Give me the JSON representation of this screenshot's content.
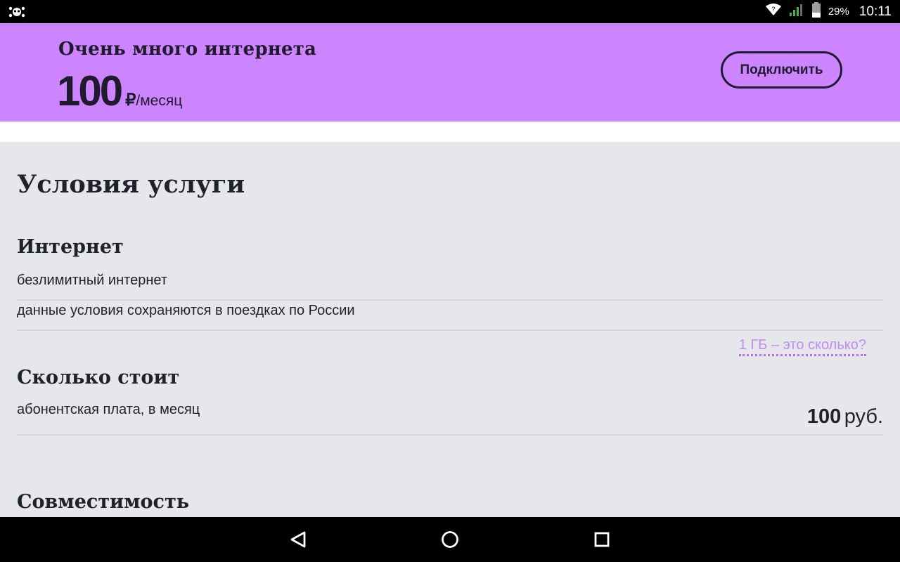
{
  "status_bar": {
    "battery": "29%",
    "time": "10:11",
    "icons": [
      "notification-icon",
      "wifi-icon",
      "signal-icon",
      "battery-icon"
    ]
  },
  "promo": {
    "title": "Очень много интернета",
    "price_value": "100",
    "currency_symbol": "₽",
    "price_period": "/месяц",
    "connect_label": "Подключить",
    "background": "#cc85ff"
  },
  "content": {
    "title": "Условия услуги",
    "internet": {
      "heading": "Интернет",
      "items": [
        "безлимитный интернет",
        "данные условия сохраняются в поездках по России"
      ],
      "help_link": "1 ГБ – это сколько?"
    },
    "cost": {
      "heading": "Сколько стоит",
      "row_label": "абонентская плата, в месяц",
      "price_value": "100",
      "price_currency": "руб."
    },
    "compat": {
      "heading": "Совместимость"
    }
  },
  "nav_bar": {
    "icons": [
      "back-icon",
      "home-icon",
      "recents-icon"
    ]
  }
}
